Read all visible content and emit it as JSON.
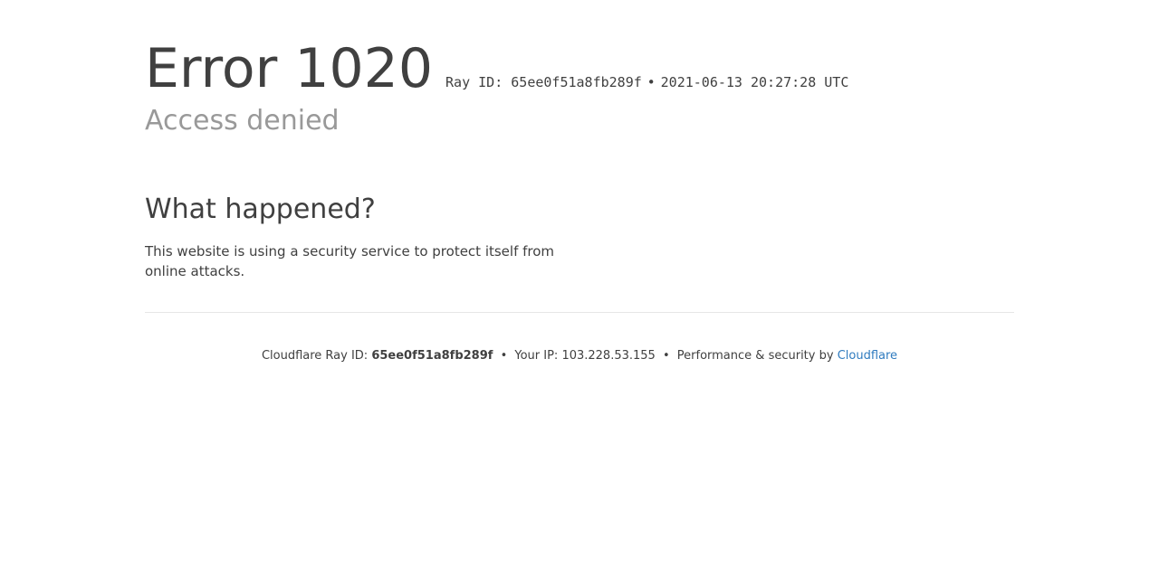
{
  "error": {
    "title": "Error 1020",
    "ray_label": "Ray ID: 65ee0f51a8fb289f",
    "bullet": "•",
    "timestamp": "2021-06-13 20:27:28 UTC",
    "subtitle": "Access denied"
  },
  "what_happened": {
    "heading": "What happened?",
    "text": "This website is using a security service to protect itself from online attacks."
  },
  "footer": {
    "ray_prefix": "Cloudflare Ray ID:",
    "ray_id": "65ee0f51a8fb289f",
    "sep": "•",
    "ip_label": "Your IP: 103.228.53.155",
    "perf_label": "Performance & security by",
    "cloudflare_link": "Cloudflare"
  },
  "colors": {
    "text": "#404040",
    "muted": "#999999",
    "link": "#2f7bbf",
    "divider": "#e6e6e6"
  }
}
